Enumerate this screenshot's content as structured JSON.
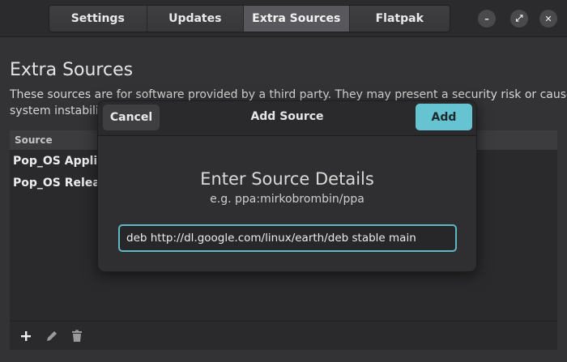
{
  "tabs": [
    {
      "label": "Settings",
      "active": false
    },
    {
      "label": "Updates",
      "active": false
    },
    {
      "label": "Extra Sources",
      "active": true
    },
    {
      "label": "Flatpak",
      "active": false
    }
  ],
  "window_controls": {
    "minimize": "–",
    "maximize": "⤢",
    "close": "✕"
  },
  "page": {
    "title": "Extra Sources",
    "description_line1": "These sources are for software provided by a third party. They may present a security risk or cause",
    "description_line2": "system instabili"
  },
  "sources_list": {
    "column_header": "Source",
    "rows": [
      {
        "label": "Pop_OS Applic"
      },
      {
        "label": "Pop_OS Releas"
      }
    ]
  },
  "footer_icons": [
    "add-icon",
    "edit-icon",
    "delete-icon"
  ],
  "dialog": {
    "title": "Add Source",
    "cancel_label": "Cancel",
    "add_label": "Add",
    "heading": "Enter Source Details",
    "example": "e.g. ppa:mirkobrombin/ppa",
    "input_value": "deb http://dl.google.com/linux/earth/deb stable main"
  },
  "colors": {
    "accent": "#66c3d1",
    "background": "#333335"
  }
}
